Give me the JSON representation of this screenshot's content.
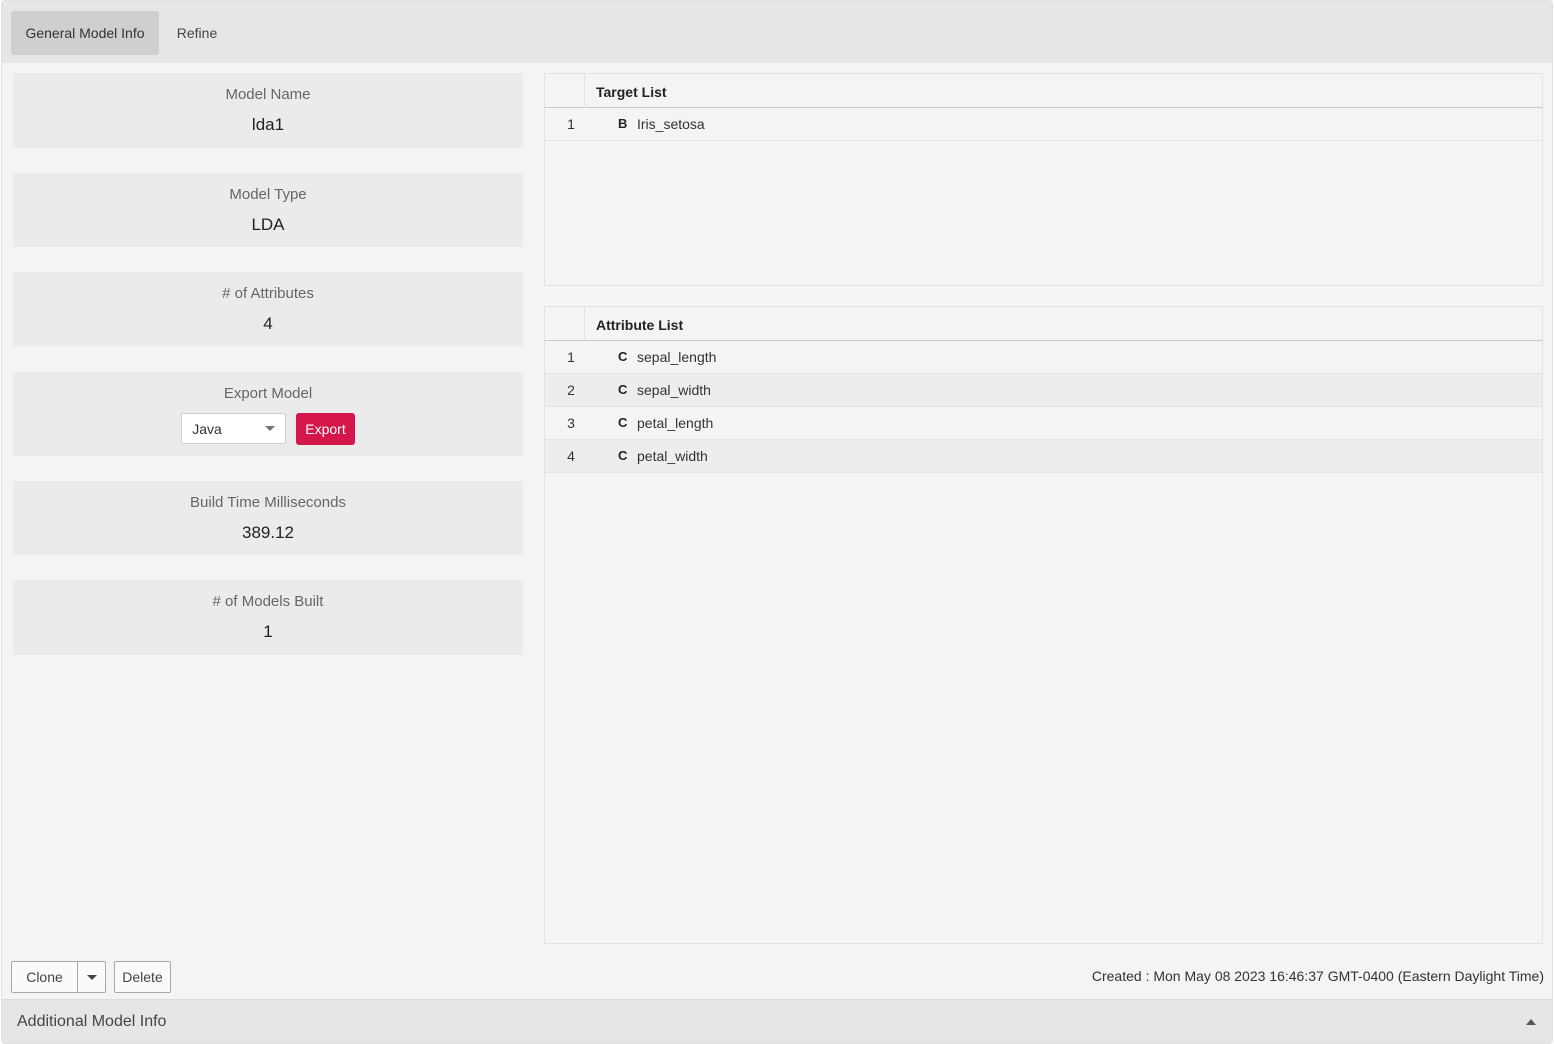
{
  "tabs": [
    {
      "label": "General Model Info",
      "active": true
    },
    {
      "label": "Refine",
      "active": false
    }
  ],
  "info": {
    "model_name": {
      "label": "Model Name",
      "value": "lda1"
    },
    "model_type": {
      "label": "Model Type",
      "value": "LDA"
    },
    "attributes": {
      "label": "# of Attributes",
      "value": "4"
    },
    "export": {
      "label": "Export Model",
      "format": "Java",
      "button": "Export"
    },
    "build_time": {
      "label": "Build Time Milliseconds",
      "value": "389.12"
    },
    "models_built": {
      "label": "# of Models Built",
      "value": "1"
    }
  },
  "target_list": {
    "title": "Target List",
    "rows": [
      {
        "index": "1",
        "type": "B",
        "name": "Iris_setosa"
      }
    ]
  },
  "attribute_list": {
    "title": "Attribute List",
    "rows": [
      {
        "index": "1",
        "type": "C",
        "name": "sepal_length"
      },
      {
        "index": "2",
        "type": "C",
        "name": "sepal_width"
      },
      {
        "index": "3",
        "type": "C",
        "name": "petal_length"
      },
      {
        "index": "4",
        "type": "C",
        "name": "petal_width"
      }
    ]
  },
  "actions": {
    "clone": "Clone",
    "delete": "Delete"
  },
  "created": "Created : Mon May 08 2023 16:46:37 GMT-0400 (Eastern Daylight Time)",
  "accordion": {
    "label": "Additional Model Info"
  },
  "colors": {
    "accent": "#d4164a"
  }
}
